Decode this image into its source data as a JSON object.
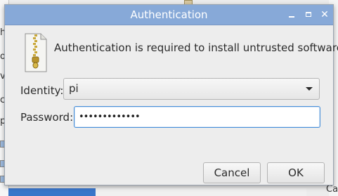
{
  "window": {
    "title": "Authentication"
  },
  "titlebar_buttons": {
    "minimize_icon": "minimize-icon",
    "maximize_icon": "maximize-icon",
    "close_symbol": "✕"
  },
  "message": "Authentication is required to install untrusted software",
  "identity": {
    "label": "Identity:",
    "value": "pi"
  },
  "password": {
    "label": "Password:",
    "value": "•••••••••••••"
  },
  "buttons": {
    "cancel": "Cancel",
    "ok": "OK"
  },
  "background": {
    "left_chars": [
      "h",
      "o",
      "v",
      "c",
      "p"
    ],
    "right_char": "Ca"
  },
  "colors": {
    "titlebar": "#87a9d8",
    "focus_border": "#4a90d9",
    "dialog_bg": "#ededed"
  }
}
